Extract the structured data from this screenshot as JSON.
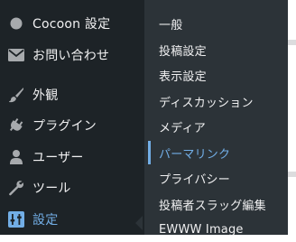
{
  "admin_menu": {
    "items": [
      {
        "label": "Cocoon 設定",
        "icon": "cocoon-circle-icon"
      },
      {
        "label": "お問い合わせ",
        "icon": "mail-icon"
      },
      {
        "label": "外観",
        "icon": "paintbrush-icon"
      },
      {
        "label": "プラグイン",
        "icon": "plugin-icon"
      },
      {
        "label": "ユーザー",
        "icon": "user-icon"
      },
      {
        "label": "ツール",
        "icon": "wrench-icon"
      },
      {
        "label": "設定",
        "icon": "settings-sliders-icon",
        "current": true
      }
    ]
  },
  "settings_submenu": {
    "items": [
      {
        "label": "一般"
      },
      {
        "label": "投稿設定"
      },
      {
        "label": "表示設定"
      },
      {
        "label": "ディスカッション"
      },
      {
        "label": "メディア"
      },
      {
        "label": "パーマリンク",
        "active": true
      },
      {
        "label": "プライバシー"
      },
      {
        "label": "投稿者スラッグ編集"
      },
      {
        "label": "EWWW Image"
      }
    ]
  },
  "colors": {
    "sidebar_bg": "#1d2327",
    "flyout_bg": "#2c3338",
    "text": "#f0f0f1",
    "accent": "#72aee6",
    "icon": "#a7aaad",
    "settings_icon": "#72aee6"
  }
}
